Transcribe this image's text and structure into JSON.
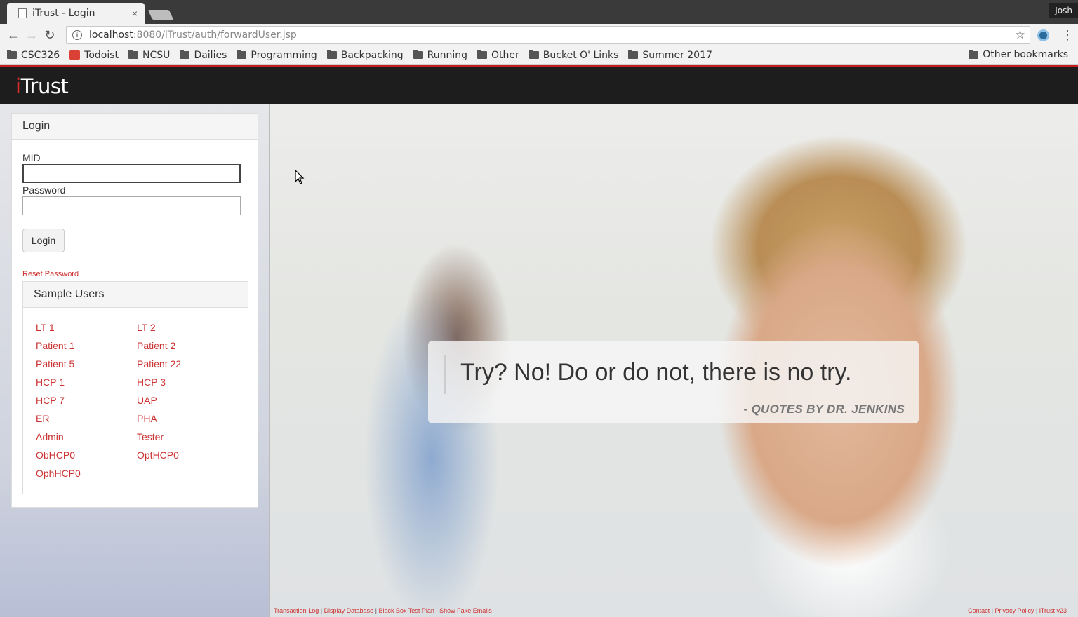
{
  "browser": {
    "tab_title": "iTrust - Login",
    "tab_close": "×",
    "profile_name": "Josh",
    "url_host": "localhost",
    "url_path": ":8080/iTrust/auth/forwardUser.jsp",
    "back_icon": "←",
    "forward_icon": "→",
    "reload_icon": "↻",
    "star_icon": "☆",
    "menu_icon": "⋮",
    "bookmarks": [
      "CSC326",
      "Todoist",
      "NCSU",
      "Dailies",
      "Programming",
      "Backpacking",
      "Running",
      "Other",
      "Bucket O' Links",
      "Summer 2017"
    ],
    "other_bookmarks": "Other bookmarks"
  },
  "header": {
    "logo_i": "i",
    "logo_rest": "Trust"
  },
  "login": {
    "title": "Login",
    "mid_label": "MID",
    "mid_value": "",
    "password_label": "Password",
    "password_value": "",
    "button_label": "Login",
    "reset_link": "Reset Password"
  },
  "sample_users": {
    "title": "Sample Users",
    "users": [
      "LT 1",
      "LT 2",
      "Patient 1",
      "Patient 2",
      "Patient 5",
      "Patient 22",
      "HCP 1",
      "HCP 3",
      "HCP 7",
      "UAP",
      "ER",
      "PHA",
      "Admin",
      "Tester",
      "ObHCP0",
      "OptHCP0",
      "OphHCP0"
    ]
  },
  "quote": {
    "text": "Try? No! Do or do not, there is no try.",
    "author": "- QUOTES BY DR. JENKINS"
  },
  "footer": {
    "left_links": [
      "Transaction Log",
      "Display Database",
      "Black Box Test Plan",
      "Show Fake Emails"
    ],
    "right_links": [
      "Contact",
      "Privacy Policy",
      "iTrust v23"
    ],
    "separator": " | "
  },
  "colors": {
    "accent": "#cc3333",
    "header_bg": "#1d1d1d",
    "header_stripe": "#c41e1e"
  }
}
